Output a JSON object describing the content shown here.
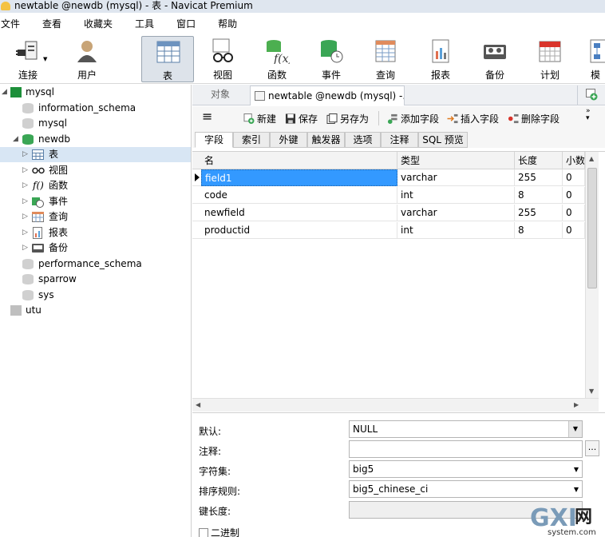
{
  "window": {
    "title": "newtable @newdb (mysql) - 表 - Navicat Premium"
  },
  "menu": [
    "文件",
    "查看",
    "收藏夹",
    "工具",
    "窗口",
    "帮助"
  ],
  "toolbar": [
    {
      "label": "连接",
      "icon": "plug-icon"
    },
    {
      "label": "用户",
      "icon": "user-icon"
    },
    {
      "label": "表",
      "icon": "table-icon",
      "active": true
    },
    {
      "label": "视图",
      "icon": "glasses-icon"
    },
    {
      "label": "函数",
      "icon": "function-icon"
    },
    {
      "label": "事件",
      "icon": "database-clock-icon"
    },
    {
      "label": "查询",
      "icon": "query-icon"
    },
    {
      "label": "报表",
      "icon": "report-icon"
    },
    {
      "label": "备份",
      "icon": "tape-icon"
    },
    {
      "label": "计划",
      "icon": "calendar-icon"
    },
    {
      "label": "模",
      "icon": "model-icon"
    }
  ],
  "tree": {
    "connection": "mysql",
    "databases": [
      "information_schema",
      "mysql"
    ],
    "open_db": "newdb",
    "objects": [
      "表",
      "视图",
      "函数",
      "事件",
      "查询",
      "报表",
      "备份"
    ],
    "more_databases": [
      "performance_schema",
      "sparrow",
      "sys"
    ],
    "other_connection": "utu"
  },
  "tabs": {
    "objects": "对象",
    "doc": "newtable @newdb (mysql) -..."
  },
  "designer_toolbar": {
    "new": "新建",
    "save": "保存",
    "save_as": "另存为",
    "add_field": "添加字段",
    "insert_field": "插入字段",
    "delete_field": "删除字段"
  },
  "subtabs": [
    "字段",
    "索引",
    "外键",
    "触发器",
    "选项",
    "注释",
    "SQL 预览"
  ],
  "grid": {
    "headers": [
      "名",
      "类型",
      "长度",
      "小数"
    ],
    "rows": [
      [
        "field1",
        "varchar",
        "255",
        "0"
      ],
      [
        "code",
        "int",
        "8",
        "0"
      ],
      [
        "newfield",
        "varchar",
        "255",
        "0"
      ],
      [
        "productid",
        "int",
        "8",
        "0"
      ]
    ]
  },
  "properties": {
    "default_label": "默认:",
    "default_value": "NULL",
    "comment_label": "注释:",
    "comment_value": "",
    "charset_label": "字符集:",
    "charset_value": "big5",
    "collation_label": "排序规则:",
    "collation_value": "big5_chinese_ci",
    "key_length_label": "键长度:",
    "binary_label": "二进制"
  },
  "watermark": {
    "text_main": "GXI网",
    "text_sub": "system.com"
  },
  "colors": {
    "selection": "#3399ff",
    "active_tool": "#dde3ea",
    "db_green": "#3aa655"
  }
}
